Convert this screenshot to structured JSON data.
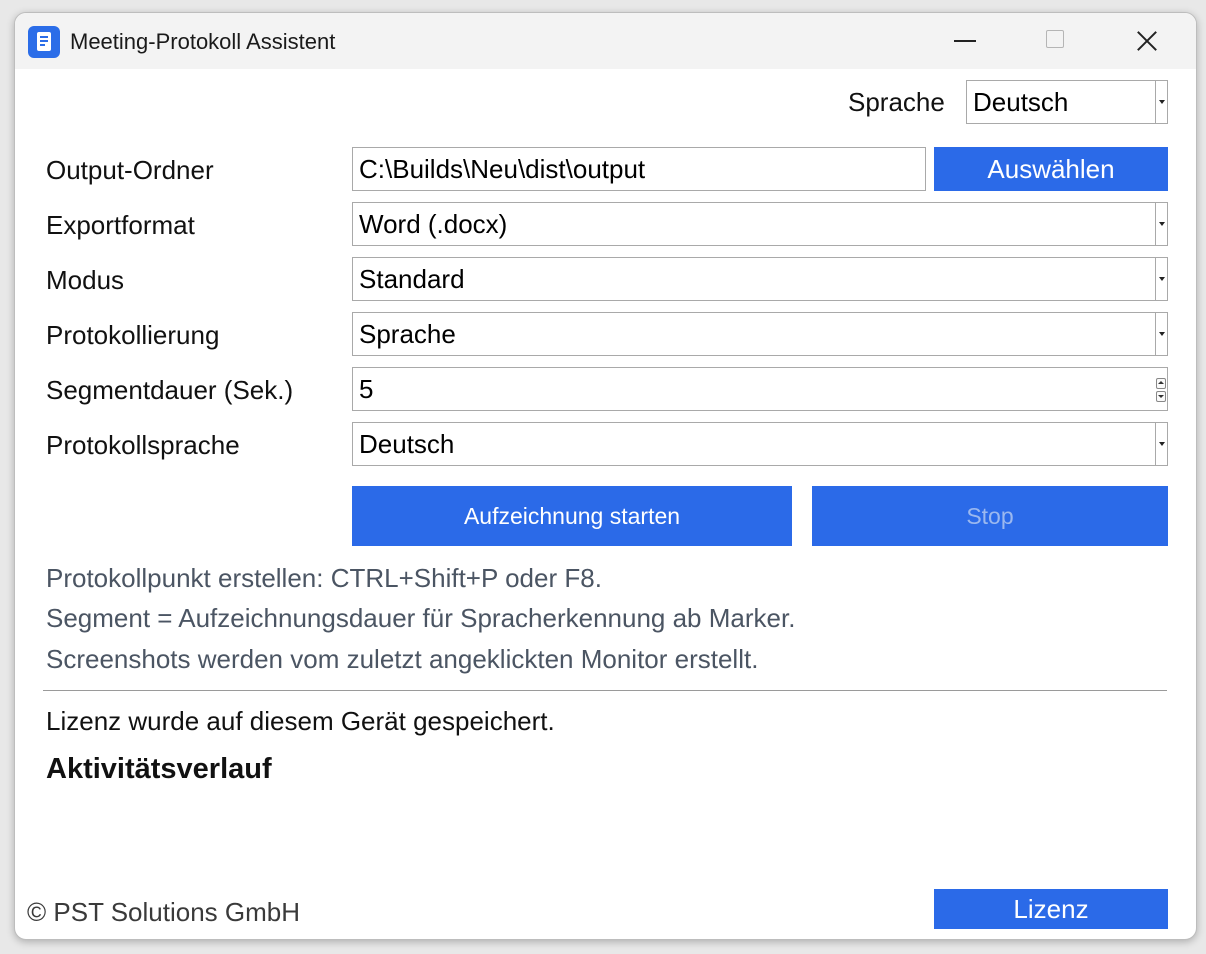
{
  "window": {
    "title": "Meeting-Protokoll Assistent",
    "app_icon": "document-icon"
  },
  "language": {
    "label": "Sprache",
    "value": "Deutsch"
  },
  "form": {
    "output_folder": {
      "label": "Output-Ordner",
      "value": "C:\\Builds\\Neu\\dist\\output",
      "button": "Auswählen"
    },
    "export_format": {
      "label": "Exportformat",
      "value": "Word (.docx)"
    },
    "mode": {
      "label": "Modus",
      "value": "Standard"
    },
    "logging": {
      "label": "Protokollierung",
      "value": "Sprache"
    },
    "segment_duration": {
      "label": "Segmentdauer (Sek.)",
      "value": "5"
    },
    "protocol_language": {
      "label": "Protokollsprache",
      "value": "Deutsch"
    }
  },
  "actions": {
    "start": "Aufzeichnung starten",
    "stop": "Stop"
  },
  "info": [
    "Protokollpunkt erstellen: CTRL+Shift+P oder F8.",
    "Segment = Aufzeichnungsdauer für Spracherkennung ab Marker.",
    "Screenshots werden vom zuletzt angeklickten Monitor erstellt."
  ],
  "license_status": "Lizenz wurde auf diesem Gerät gespeichert.",
  "activity_heading": "Aktivitätsverlauf",
  "footer": {
    "copyright": "© PST Solutions GmbH",
    "license_button": "Lizenz"
  },
  "colors": {
    "accent": "#2b6ae8",
    "info_text": "#4b5563"
  }
}
